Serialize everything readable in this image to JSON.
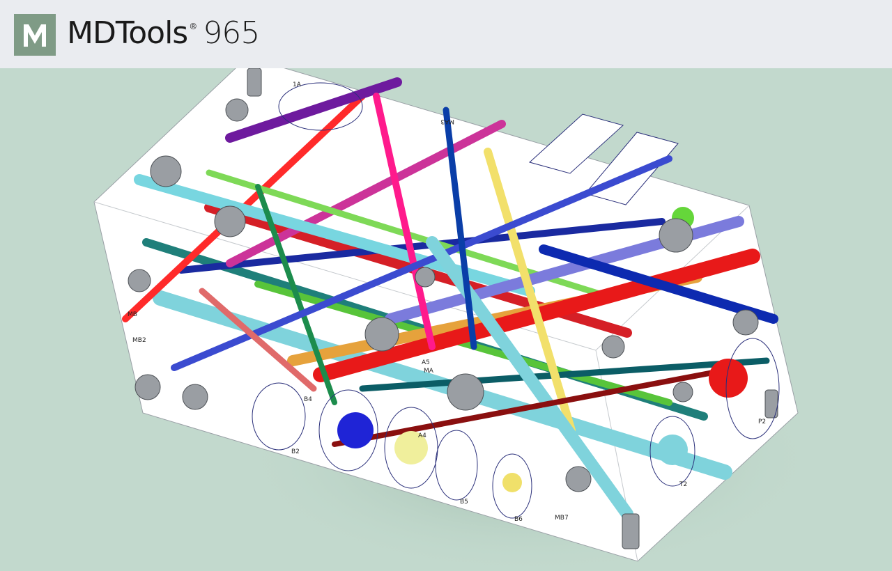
{
  "header": {
    "brand": "MDTools",
    "reg_mark": "®",
    "version": "965",
    "logo_letter": "M"
  },
  "colors": {
    "header_bg": "#eaecf0",
    "viewport_bg": "#c2d9cd",
    "logo_badge": "#7f9b86",
    "block_face": "#ffffff"
  },
  "model": {
    "port_labels": {
      "b2": "B2",
      "b4": "B4",
      "b5": "B5",
      "b6": "B6",
      "mb7": "MB7",
      "t2": "T2",
      "p2": "P2",
      "mb2": "MB2",
      "mb": "MB",
      "a4": "A4",
      "a5": "A5",
      "ma": "MA",
      "ma3": "MA3",
      "a1": "1A"
    }
  }
}
